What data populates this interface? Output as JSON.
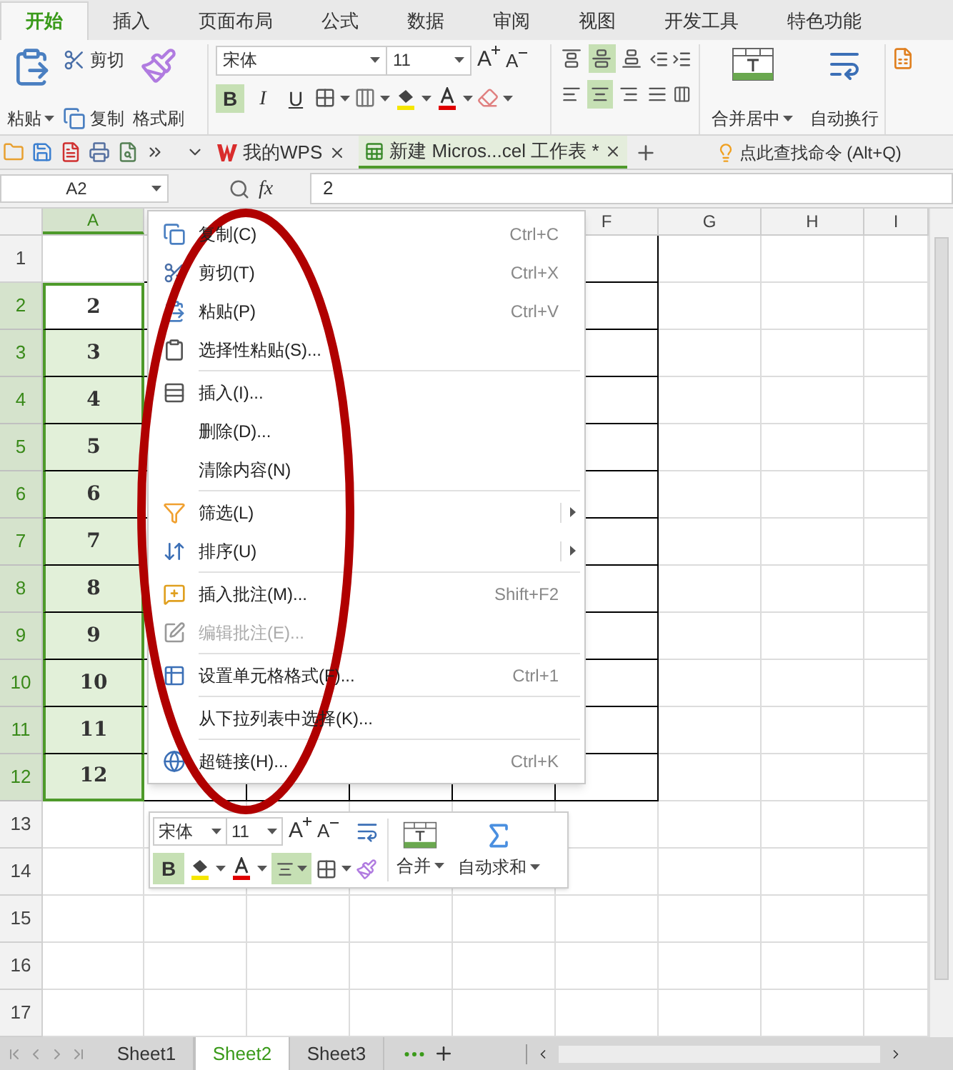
{
  "ribbon_tabs": [
    {
      "label": "开始",
      "selected": true
    },
    {
      "label": "插入",
      "selected": false
    },
    {
      "label": "页面布局",
      "selected": false
    },
    {
      "label": "公式",
      "selected": false
    },
    {
      "label": "数据",
      "selected": false
    },
    {
      "label": "审阅",
      "selected": false
    },
    {
      "label": "视图",
      "selected": false
    },
    {
      "label": "开发工具",
      "selected": false
    },
    {
      "label": "特色功能",
      "selected": false
    }
  ],
  "clipboard": {
    "paste": "粘贴",
    "cut": "剪切",
    "copy": "复制",
    "format_painter": "格式刷"
  },
  "font": {
    "name": "宋体",
    "size": "11",
    "grow": "A",
    "shrink": "A"
  },
  "font_styles": [
    {
      "label": "B",
      "on": true
    },
    {
      "label": "I",
      "on": false
    },
    {
      "label": "U",
      "on": false
    }
  ],
  "vertical_align": [
    {
      "selected": false
    },
    {
      "selected": true
    },
    {
      "selected": false
    }
  ],
  "horizontal_align": [
    {
      "selected": false
    },
    {
      "selected": true
    },
    {
      "selected": false
    },
    {
      "selected": false
    }
  ],
  "merge": "合并居中",
  "wrap": "自动换行",
  "doc_tabs": [
    {
      "label": "我的WPS",
      "selected": false,
      "kind": "wps"
    },
    {
      "label": "新建 Micros...cel 工作表 *",
      "selected": true,
      "kind": "sheet"
    }
  ],
  "command_search": "点此查找命令 (Alt+Q)",
  "formula_bar": {
    "name_box": "A2",
    "fx": "fx",
    "value": "2"
  },
  "columns": [
    {
      "label": "A",
      "selected": true
    },
    {
      "label": "F",
      "selected": false
    },
    {
      "label": "G",
      "selected": false
    },
    {
      "label": "H",
      "selected": false
    },
    {
      "label": "I",
      "selected": false
    }
  ],
  "rows": [
    {
      "label": "1",
      "selected": false
    },
    {
      "label": "2",
      "selected": true,
      "value": "2"
    },
    {
      "label": "3",
      "selected": true,
      "value": "3"
    },
    {
      "label": "4",
      "selected": true,
      "value": "4"
    },
    {
      "label": "5",
      "selected": true,
      "value": "5"
    },
    {
      "label": "6",
      "selected": true,
      "value": "6"
    },
    {
      "label": "7",
      "selected": true,
      "value": "7"
    },
    {
      "label": "8",
      "selected": true,
      "value": "8"
    },
    {
      "label": "9",
      "selected": true,
      "value": "9"
    },
    {
      "label": "10",
      "selected": true,
      "value": "10"
    },
    {
      "label": "11",
      "selected": true,
      "value": "11"
    },
    {
      "label": "12",
      "selected": true,
      "value": "12"
    },
    {
      "label": "13",
      "selected": false
    },
    {
      "label": "14",
      "selected": false
    },
    {
      "label": "15",
      "selected": false
    },
    {
      "label": "16",
      "selected": false
    },
    {
      "label": "17",
      "selected": false
    }
  ],
  "context_menu": [
    {
      "label": "复制(C)",
      "shortcut": "Ctrl+C",
      "separator_before": false,
      "disabled": false,
      "submenu": false
    },
    {
      "label": "剪切(T)",
      "shortcut": "Ctrl+X",
      "separator_before": false,
      "disabled": false,
      "submenu": false
    },
    {
      "label": "粘贴(P)",
      "shortcut": "Ctrl+V",
      "separator_before": false,
      "disabled": false,
      "submenu": false
    },
    {
      "label": "选择性粘贴(S)...",
      "separator_before": false,
      "disabled": false,
      "submenu": false
    },
    {
      "label": "插入(I)...",
      "separator_before": true,
      "disabled": false,
      "submenu": false
    },
    {
      "label": "删除(D)...",
      "separator_before": false,
      "disabled": false,
      "submenu": false
    },
    {
      "label": "清除内容(N)",
      "separator_before": false,
      "disabled": false,
      "submenu": false
    },
    {
      "label": "筛选(L)",
      "separator_before": true,
      "disabled": false,
      "submenu": true
    },
    {
      "label": "排序(U)",
      "separator_before": false,
      "disabled": false,
      "submenu": true
    },
    {
      "label": "插入批注(M)...",
      "shortcut": "Shift+F2",
      "separator_before": true,
      "disabled": false,
      "submenu": false
    },
    {
      "label": "编辑批注(E)...",
      "separator_before": false,
      "disabled": true,
      "submenu": false
    },
    {
      "label": "设置单元格格式(F)...",
      "shortcut": "Ctrl+1",
      "separator_before": true,
      "disabled": false,
      "submenu": false
    },
    {
      "label": "从下拉列表中选择(K)...",
      "separator_before": true,
      "disabled": false,
      "submenu": false
    },
    {
      "label": "超链接(H)...",
      "shortcut": "Ctrl+K",
      "separator_before": true,
      "disabled": false,
      "submenu": false
    }
  ],
  "mini_toolbar": {
    "font": "宋体",
    "size": "11",
    "grow": "A",
    "shrink": "A",
    "bold": {
      "label": "B",
      "on": true
    },
    "center": true,
    "merge": "合并",
    "autosum": "自动求和"
  },
  "sheet_tabs": [
    {
      "label": "Sheet1",
      "selected": false
    },
    {
      "label": "Sheet2",
      "selected": true
    },
    {
      "label": "Sheet3",
      "selected": false
    }
  ]
}
